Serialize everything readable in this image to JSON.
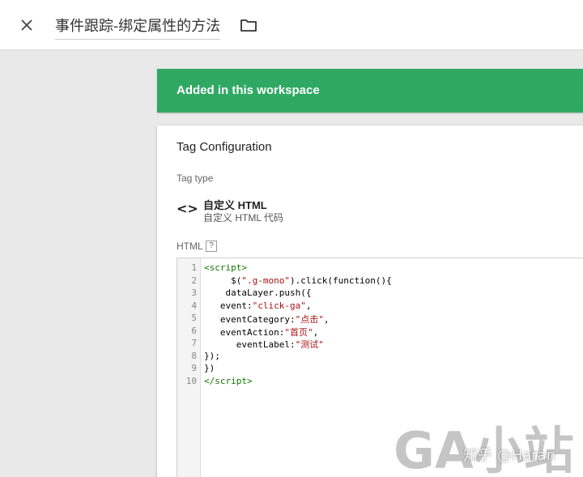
{
  "header": {
    "title": "事件跟踪-绑定属性的方法",
    "close_icon": "close-icon",
    "folder_icon": "folder-icon"
  },
  "banner": {
    "text": "Added in this workspace",
    "color": "#2fa863"
  },
  "card": {
    "title": "Tag Configuration",
    "tag_type_label": "Tag type",
    "tag_type_icon": "code-icon",
    "tag_type_icon_glyph": "<>",
    "tag_type_name": "自定义 HTML",
    "tag_type_desc": "自定义 HTML 代码",
    "html_label": "HTML",
    "help_glyph": "?"
  },
  "editor": {
    "line_numbers": [
      "1",
      "2",
      "3",
      "4",
      "5",
      "6",
      "7",
      "8",
      "9",
      "10"
    ]
  },
  "watermark": {
    "main": "GA小站",
    "sub": "知乎 @Haran"
  }
}
